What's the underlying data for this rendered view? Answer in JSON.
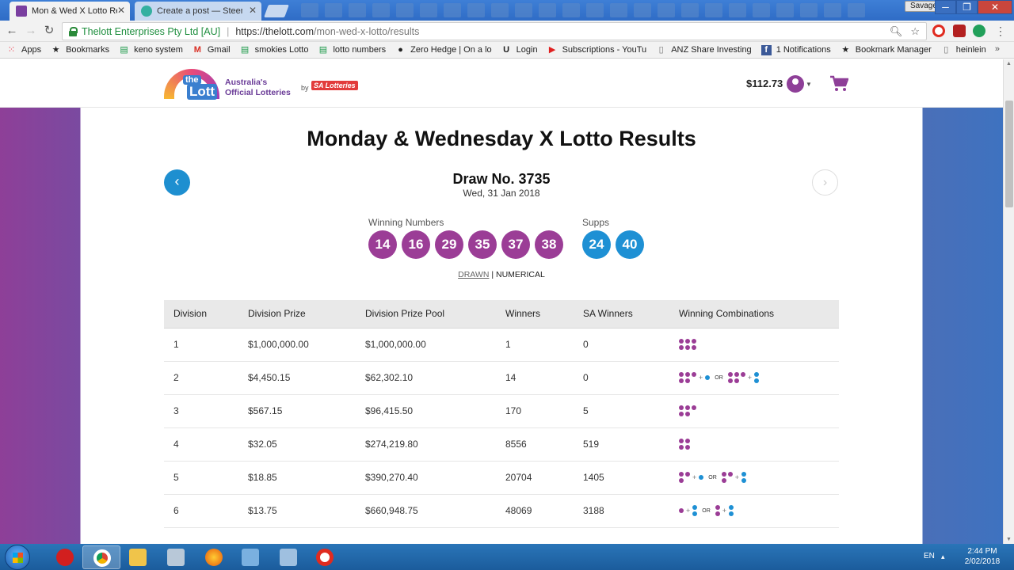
{
  "browser": {
    "tabs": [
      {
        "title": "Mon & Wed X Lotto Resu",
        "active": true
      },
      {
        "title": "Create a post — Steemit",
        "active": false
      }
    ],
    "profile_name": "Savage",
    "security_label": "Thelott Enterprises Pty Ltd [AU]",
    "url_base": "https://thelott.com",
    "url_path": "/mon-wed-x-lotto/results"
  },
  "bookmarks": [
    {
      "label": "Apps",
      "icon": "apps-grid-icon"
    },
    {
      "label": "Bookmarks",
      "icon": "star-icon"
    },
    {
      "label": "keno system",
      "icon": "sheets-icon"
    },
    {
      "label": "Gmail",
      "icon": "gmail-icon"
    },
    {
      "label": "smokies Lotto",
      "icon": "sheets-icon"
    },
    {
      "label": "lotto numbers",
      "icon": "sheets-icon"
    },
    {
      "label": "Zero Hedge | On a lo",
      "icon": "zerohedge-icon"
    },
    {
      "label": "Login",
      "icon": "login-icon"
    },
    {
      "label": "Subscriptions - YouTu",
      "icon": "youtube-icon"
    },
    {
      "label": "ANZ Share Investing",
      "icon": "page-icon"
    },
    {
      "label": "1 Notifications",
      "icon": "facebook-icon"
    },
    {
      "label": "Bookmark Manager",
      "icon": "star-icon"
    },
    {
      "label": "heinlein",
      "icon": "page-icon"
    }
  ],
  "site": {
    "logo_the": "the",
    "logo_lott": "Lott",
    "tagline_1": "Australia's",
    "tagline_2": "Official Lotteries",
    "by": "by",
    "partner": "SA Lotteries",
    "balance": "$112.73"
  },
  "results": {
    "title": "Monday & Wednesday X Lotto Results",
    "draw_no": "Draw No. 3735",
    "draw_date": "Wed, 31 Jan 2018",
    "winning_label": "Winning Numbers",
    "supps_label": "Supps",
    "winning_numbers": [
      "14",
      "16",
      "29",
      "35",
      "37",
      "38"
    ],
    "supps": [
      "24",
      "40"
    ],
    "order_drawn": "DRAWN",
    "order_sep": "|",
    "order_numerical": "NUMERICAL",
    "colors": {
      "winning": "#9b3d96",
      "supp": "#1e90d4"
    }
  },
  "table": {
    "headers": [
      "Division",
      "Division Prize",
      "Division Prize Pool",
      "Winners",
      "SA Winners",
      "Winning Combinations"
    ],
    "rows": [
      {
        "division": "1",
        "prize": "$1,000,000.00",
        "pool": "$1,000,000.00",
        "winners": "1",
        "sa_winners": "0"
      },
      {
        "division": "2",
        "prize": "$4,450.15",
        "pool": "$62,302.10",
        "winners": "14",
        "sa_winners": "0"
      },
      {
        "division": "3",
        "prize": "$567.15",
        "pool": "$96,415.50",
        "winners": "170",
        "sa_winners": "5"
      },
      {
        "division": "4",
        "prize": "$32.05",
        "pool": "$274,219.80",
        "winners": "8556",
        "sa_winners": "519"
      },
      {
        "division": "5",
        "prize": "$18.85",
        "pool": "$390,270.40",
        "winners": "20704",
        "sa_winners": "1405"
      },
      {
        "division": "6",
        "prize": "$13.75",
        "pool": "$660,948.75",
        "winners": "48069",
        "sa_winners": "3188"
      }
    ],
    "combo_or": "OR"
  },
  "taskbar": {
    "lang": "EN",
    "time": "2:44 PM",
    "date": "2/02/2018"
  }
}
